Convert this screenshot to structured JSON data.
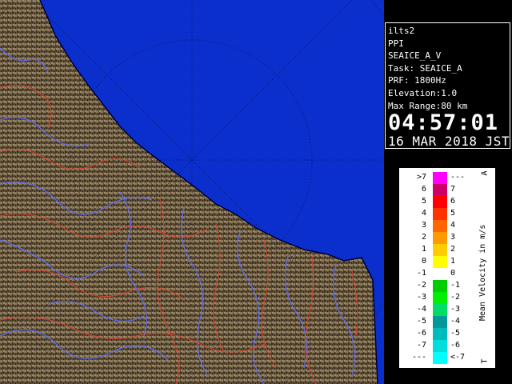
{
  "info": {
    "site": "ilts2",
    "product": "PPI",
    "field": "SEAICE_A_V",
    "task": "Task: SEAICE_A",
    "prf": "PRF: 1800Hz",
    "elevation": "Elevation:1.0",
    "max_range": "Max Range:80 km",
    "time": "04:57:01",
    "date": "16 MAR 2018 JST"
  },
  "legend": {
    "title": "Mean Velocity in m/s",
    "corner_top": "A",
    "corner_bottom": "T",
    "left_labels": [
      ">7",
      "6",
      "5",
      "4",
      "3",
      "2",
      "1",
      "0",
      "-1",
      "-2",
      "-3",
      "-4",
      "-5",
      "-6",
      "-7",
      "---"
    ],
    "right_labels": [
      "---",
      "7",
      "6",
      "5",
      "4",
      "3",
      "2",
      "1",
      "0",
      "-1",
      "-2",
      "-3",
      "-4",
      "-5",
      "-6",
      "<-7"
    ],
    "colors": [
      "#ff00ff",
      "#cc0066",
      "#ff0000",
      "#ff3300",
      "#ff6600",
      "#ff9900",
      "#ffcc00",
      "#ffff00",
      "#ffffff",
      "#00cc00",
      "#00ee00",
      "#00dd66",
      "#009999",
      "#00bbbb",
      "#00dddd",
      "#00ffff"
    ]
  },
  "map": {
    "sea_color": "#0a2fcc",
    "land_color": "#6a5a40",
    "river_color": "#5a6cff",
    "boundary_color": "#e0402a"
  }
}
